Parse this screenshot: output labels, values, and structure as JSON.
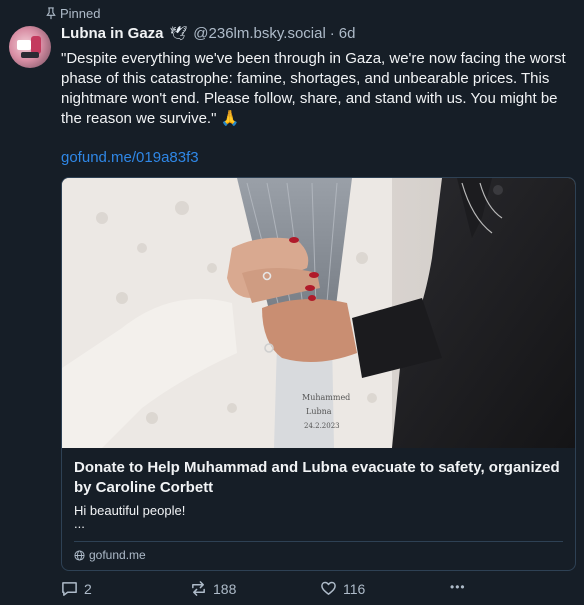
{
  "pinned": {
    "label": "Pinned",
    "icon": "pin-icon"
  },
  "author": {
    "display_name": "Lubna in Gaza",
    "badge": "🕊",
    "handle": "@236lm.bsky.social",
    "separator": "·",
    "time": "6d"
  },
  "post": {
    "text": "\"Despite everything we've been through in Gaza, we're now facing the worst phase of this catastrophe: famine, shortages, and unbearable prices. This nightmare won't end. Please follow, share, and stand with us. You might be the reason we survive.\" 🙏",
    "link": "gofund.me/019a83f3"
  },
  "embed": {
    "title": "Donate to Help Muhammad and Lubna evacuate to safety, organized by Caroline Corbett",
    "description": "Hi beautiful people!",
    "ellipsis": "...",
    "domain": "gofund.me",
    "domain_icon": "globe-icon"
  },
  "actions": {
    "reply_count": "2",
    "repost_count": "188",
    "like_count": "116",
    "more_label": "•••"
  },
  "colors": {
    "background": "#161e27",
    "text": "#f1f3f5",
    "muted": "#aebbc9",
    "link": "#2f87e6",
    "border": "#2e4154"
  }
}
